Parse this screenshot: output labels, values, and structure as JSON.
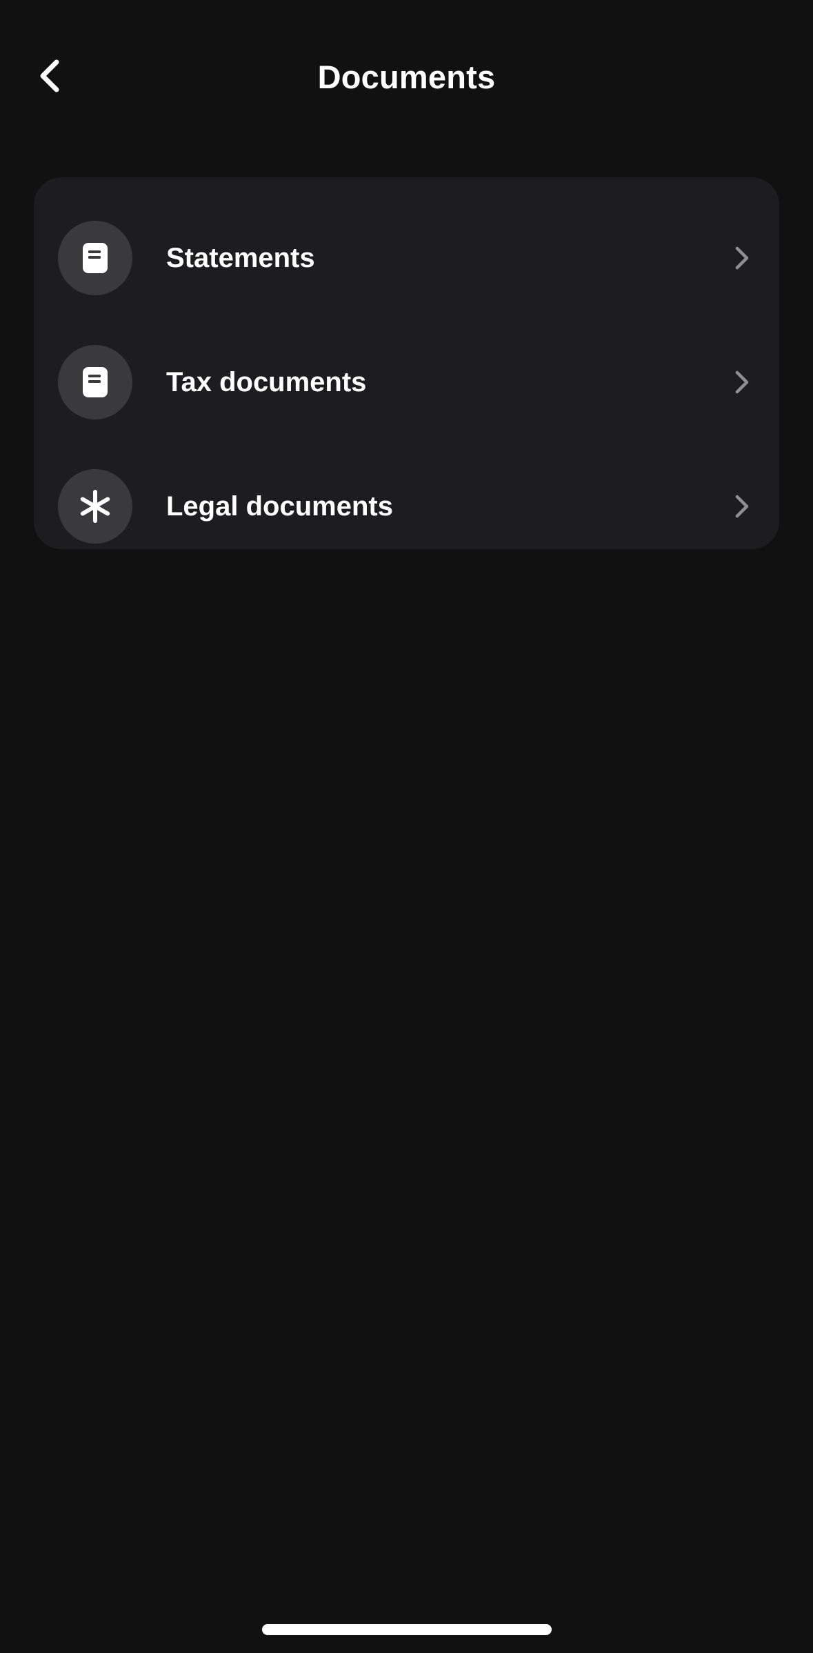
{
  "header": {
    "title": "Documents",
    "back_icon": "chevron-left-icon"
  },
  "documents_list": {
    "items": [
      {
        "label": "Statements",
        "icon": "document-icon"
      },
      {
        "label": "Tax documents",
        "icon": "document-icon"
      },
      {
        "label": "Legal documents",
        "icon": "asterisk-icon"
      }
    ]
  },
  "colors": {
    "background": "#111111",
    "card": "#1d1d1f",
    "icon_circle": "#3a3a3c",
    "text": "#ffffff",
    "chevron": "#8e8e93"
  }
}
